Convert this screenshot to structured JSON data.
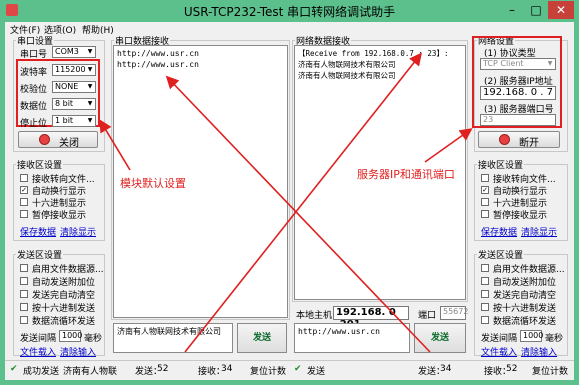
{
  "window": {
    "title": "USR-TCP232-Test 串口转网络调试助手",
    "min": "–",
    "max": "□",
    "close": "✕"
  },
  "menu": [
    "文件(F)",
    "选项(O)",
    "帮助(H)"
  ],
  "serial": {
    "group_title": "串口设置",
    "rows": [
      {
        "label": "串口号",
        "value": "COM3"
      },
      {
        "label": "波特率",
        "value": "115200"
      },
      {
        "label": "校验位",
        "value": "NONE"
      },
      {
        "label": "数据位",
        "value": "8 bit"
      },
      {
        "label": "停止位",
        "value": "1 bit"
      }
    ],
    "close_btn": "关闭"
  },
  "recv_left": {
    "group_title": "接收区设置",
    "options": [
      {
        "label": "接收转向文件...",
        "checked": false
      },
      {
        "label": "自动换行显示",
        "checked": true
      },
      {
        "label": "十六进制显示",
        "checked": false
      },
      {
        "label": "暂停接收显示",
        "checked": false
      }
    ],
    "save": "保存数据",
    "clear": "清除显示"
  },
  "send_left": {
    "group_title": "发送区设置",
    "options": [
      {
        "label": "启用文件数据源...",
        "checked": false
      },
      {
        "label": "自动发送附加位",
        "checked": false
      },
      {
        "label": "发送完自动清空",
        "checked": false
      },
      {
        "label": "按十六进制发送",
        "checked": false
      },
      {
        "label": "数据流循环发送",
        "checked": false
      }
    ],
    "interval_label": "发送间隔",
    "interval_value": "1000",
    "interval_unit": "毫秒",
    "file_load": "文件载入",
    "clear_input": "清除输入"
  },
  "serial_recv": {
    "title": "串口数据接收",
    "text": "http://www.usr.cn\nhttp://www.usr.cn"
  },
  "serial_send": {
    "text": "济南有人物联网技术有限公司",
    "send": "发送"
  },
  "net_recv": {
    "title": "网络数据接收",
    "text": "【Receive from 192.168.0.7 : 23】:\n济南有人物联网技术有限公司\n济南有人物联网技术有限公司"
  },
  "net_host": {
    "host_label": "本地主机",
    "host_value": "192.168. 0 .201",
    "port_label": "端口",
    "port_value": "55672"
  },
  "net_send": {
    "text": "http://www.usr.cn",
    "send": "发送"
  },
  "net_settings": {
    "group_title": "网络设置",
    "protocol_label": "(1) 协议类型",
    "protocol_value": "TCP Client",
    "ip_label": "(2) 服务器IP地址",
    "ip_value": "192.168. 0 . 7",
    "port_label": "(3) 服务器端口号",
    "port_value": "23",
    "disconnect_btn": "断开"
  },
  "recv_right": {
    "group_title": "接收区设置",
    "options": [
      {
        "label": "接收转向文件...",
        "checked": false
      },
      {
        "label": "自动换行显示",
        "checked": true
      },
      {
        "label": "十六进制显示",
        "checked": false
      },
      {
        "label": "暂停接收显示",
        "checked": false
      }
    ],
    "save": "保存数据",
    "clear": "清除显示"
  },
  "send_right": {
    "group_title": "发送区设置",
    "options": [
      {
        "label": "启用文件数据源...",
        "checked": false
      },
      {
        "label": "自动发送附加位",
        "checked": false
      },
      {
        "label": "发送完自动清空",
        "checked": false
      },
      {
        "label": "按十六进制发送",
        "checked": false
      },
      {
        "label": "数据流循环发送",
        "checked": false
      }
    ],
    "interval_label": "发送间隔",
    "interval_value": "1000",
    "interval_unit": "毫秒",
    "file_load": "文件载入",
    "clear_input": "清除输入"
  },
  "status_left": {
    "state": "成功发送",
    "text": "济南有人物联",
    "send_label": "发送：",
    "send_count": "52",
    "recv_label": "接收：",
    "recv_count": "34",
    "reset": "复位计数"
  },
  "status_right": {
    "state": "发送",
    "send_label": "发送：",
    "send_count": "34",
    "recv_label": "接收：",
    "recv_count": "52",
    "reset": "复位计数"
  },
  "annotations": {
    "left": "模块默认设置",
    "right": "服务器IP和通讯端口"
  },
  "colors": {
    "title_bg": "#5cc08c",
    "annotation_red": "#e02020",
    "link_blue": "#0000cc"
  }
}
